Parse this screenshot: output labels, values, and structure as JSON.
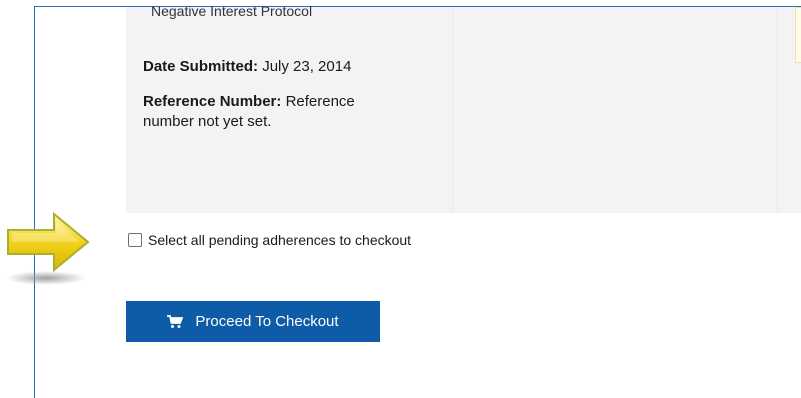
{
  "adherence_card": {
    "protocol_name": "Negative Interest Protocol",
    "date_label": "Date Submitted:",
    "date_value": "July 23, 2014",
    "reference_label": "Reference Number:",
    "reference_value": "Reference number not yet set."
  },
  "select_all": {
    "label": "Select all pending adherences to checkout",
    "checked": false
  },
  "checkout_button": {
    "label": "Proceed To Checkout",
    "icon": "cart-icon"
  },
  "colors": {
    "accent": "#0e5ba7",
    "panel": "#f4f2f5",
    "callout_arrow": "#f2d31b",
    "frame_border": "#1f6fc5"
  }
}
